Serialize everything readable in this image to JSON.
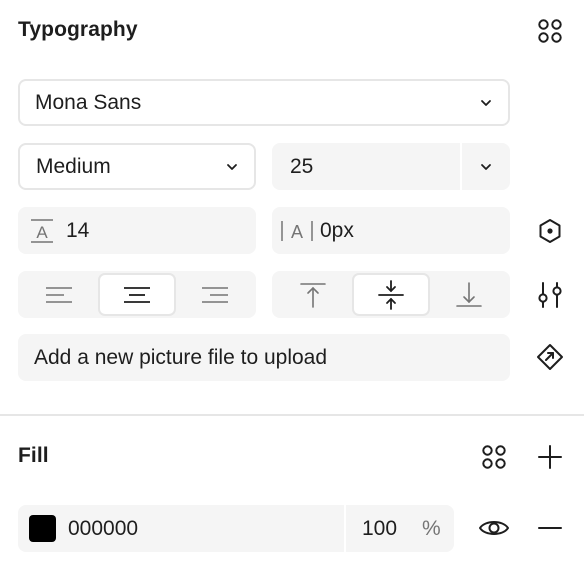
{
  "typography": {
    "title": "Typography",
    "font_family": "Mona Sans",
    "font_weight": "Medium",
    "font_size": "25",
    "line_height": "14",
    "letter_spacing": "0px",
    "upload_text": "Add a new picture file to upload",
    "icons": {
      "styles": "grid-dots-icon",
      "variable": "hexagon-icon",
      "settings": "sliders-icon",
      "component": "diamond-link-icon"
    }
  },
  "fill": {
    "title": "Fill",
    "hex": "000000",
    "opacity": "100",
    "opacity_unit": "%",
    "color": "#000000"
  },
  "colors": {
    "field_bg": "#f5f5f5",
    "border": "#e6e6e6",
    "text": "#1e1e1e",
    "muted": "#757575"
  }
}
